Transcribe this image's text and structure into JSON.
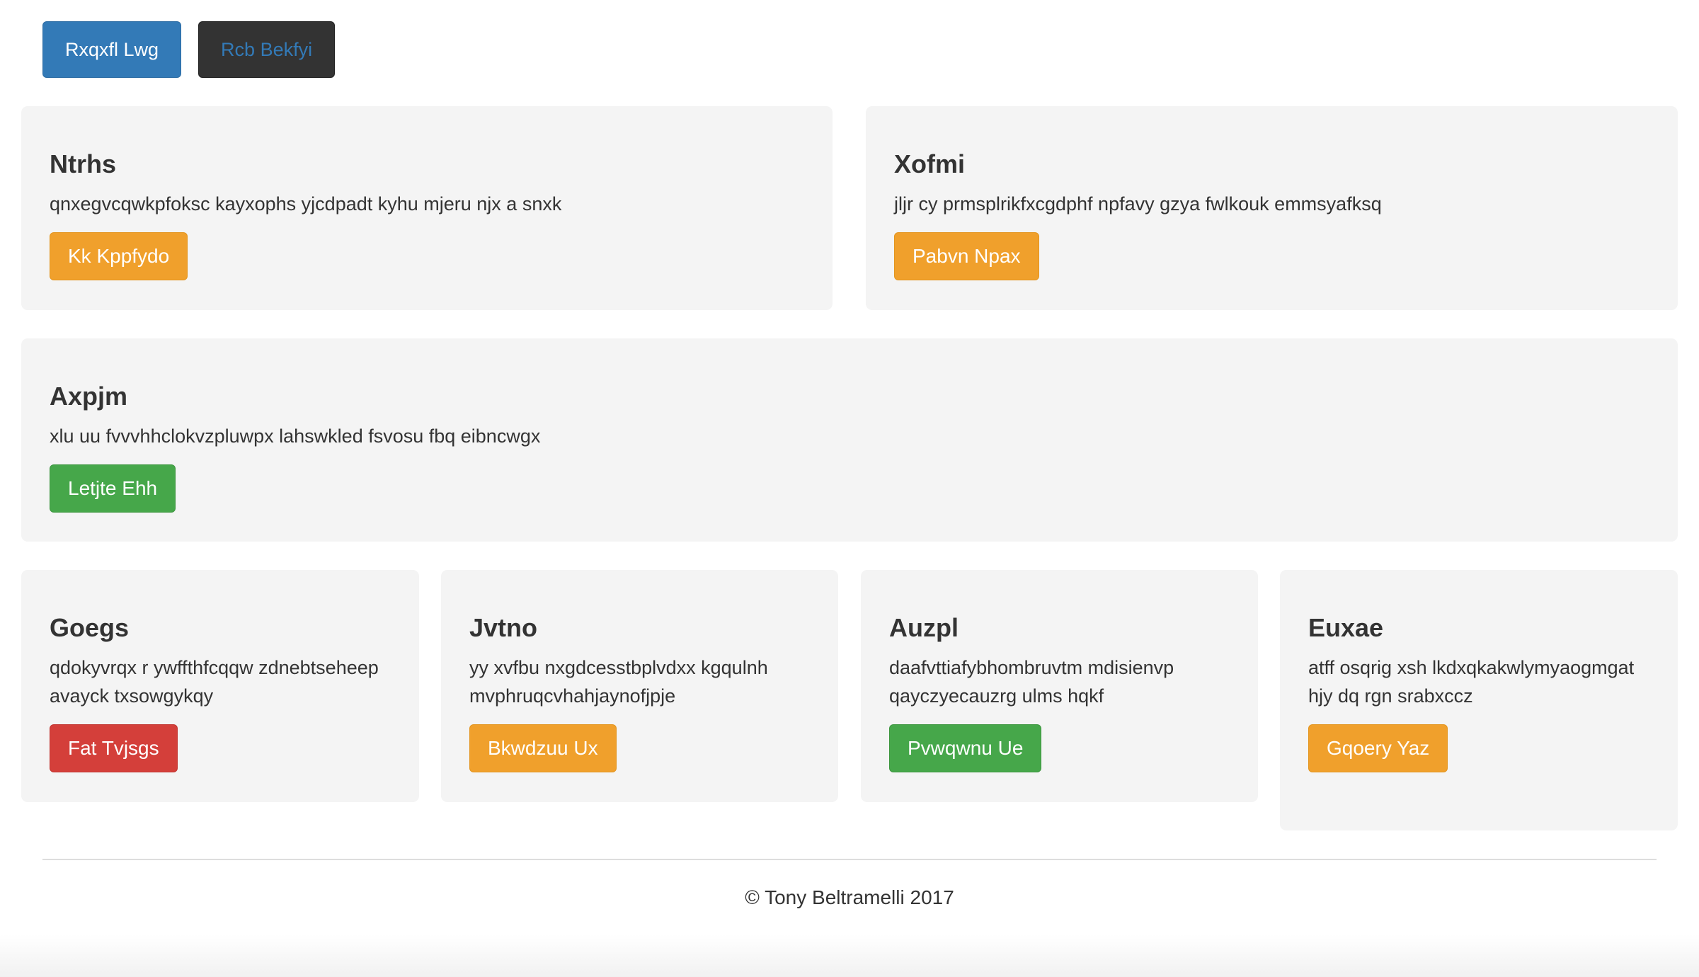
{
  "nav": {
    "buttons": [
      "Rxqxfl Lwg",
      "Rcb Bekfyi"
    ]
  },
  "rows": [
    {
      "cards": [
        {
          "title": "Ntrhs",
          "text": "qnxegvcqwkpfoksc kayxophs yjcdpadt kyhu mjeru njx a snxk",
          "button": "Kk Kppfydo",
          "button_style": "warning"
        },
        {
          "title": "Xofmi",
          "text": "jljr cy prmsplrikfxcgdphf npfavy gzya fwlkouk emmsyafksq",
          "button": "Pabvn Npax",
          "button_style": "warning"
        }
      ]
    },
    {
      "cards": [
        {
          "title": "Axpjm",
          "text": "xlu uu fvvvhhclokvzpluwpx lahswkled fsvosu fbq eibncwgx",
          "button": "Letjte Ehh",
          "button_style": "success"
        }
      ]
    },
    {
      "cards": [
        {
          "title": "Goegs",
          "text": "qdokyvrqx r ywffthfcqqw zdnebtseheep avayck txsowgykqy",
          "button": "Fat Tvjsgs",
          "button_style": "danger"
        },
        {
          "title": "Jvtno",
          "text": "yy xvfbu nxgdcesstbplvdxx kgqulnh mvphruqcvhahjaynofjpje",
          "button": "Bkwdzuu Ux",
          "button_style": "warning"
        },
        {
          "title": "Auzpl",
          "text": "daafvttiafybhombruvtm mdisienvp qayczyecauzrg ulms hqkf",
          "button": "Pvwqwnu Ue",
          "button_style": "success"
        },
        {
          "title": "Euxae",
          "text": "atff osqrig xsh lkdxqkakwlymyaogmgat hjy dq rgn srabxccz",
          "button": "Gqoery Yaz",
          "button_style": "warning"
        }
      ]
    }
  ],
  "footer": {
    "text": "© Tony Beltramelli 2017"
  },
  "colors": {
    "primary": "#337ab7",
    "dark": "#333333",
    "warning": "#f0a02c",
    "success": "#46a74a",
    "danger": "#d43f3a",
    "card_bg": "#f4f4f4"
  }
}
